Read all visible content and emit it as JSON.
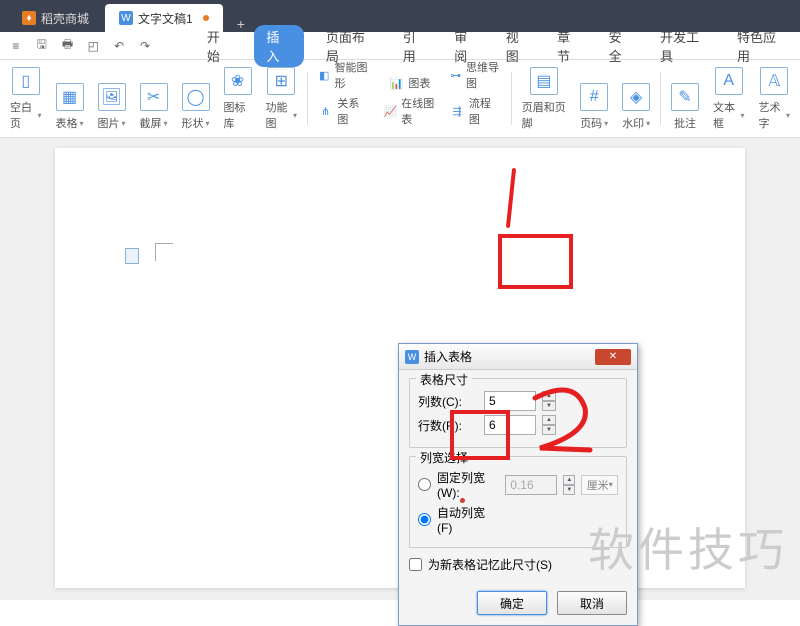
{
  "tabs": {
    "shell": "稻壳商城",
    "doc": "文字文稿1"
  },
  "menu": {
    "start": "开始",
    "insert": "插入",
    "layout": "页面布局",
    "ref": "引用",
    "review": "审阅",
    "view": "视图",
    "chapter": "章节",
    "security": "安全",
    "dev": "开发工具",
    "special": "特色应用"
  },
  "ribbon": {
    "blank": "空白页",
    "table": "表格",
    "picture": "图片",
    "screenshot": "截屏",
    "shape": "形状",
    "gallery": "图标库",
    "feature": "功能图",
    "smartart": "智能图形",
    "chart": "图表",
    "relation": "关系图",
    "onlinechart": "在线图表",
    "mindmap": "思维导图",
    "flowchart": "流程图",
    "headerfooter": "页眉和页脚",
    "pagenum": "页码",
    "watermark": "水印",
    "comment": "批注",
    "textbox": "文本框",
    "wordart": "艺术字"
  },
  "dialog": {
    "title": "插入表格",
    "size_legend": "表格尺寸",
    "cols_label": "列数(C):",
    "cols_value": "5",
    "rows_label": "行数(R):",
    "rows_value": "6",
    "width_legend": "列宽选择",
    "fixed_label": "固定列宽(W):",
    "fixed_value": "0.16",
    "unit": "厘米",
    "auto_label": "自动列宽(F)",
    "remember": "为新表格记忆此尺寸(S)",
    "ok": "确定",
    "cancel": "取消"
  },
  "watermark": "软件技巧"
}
